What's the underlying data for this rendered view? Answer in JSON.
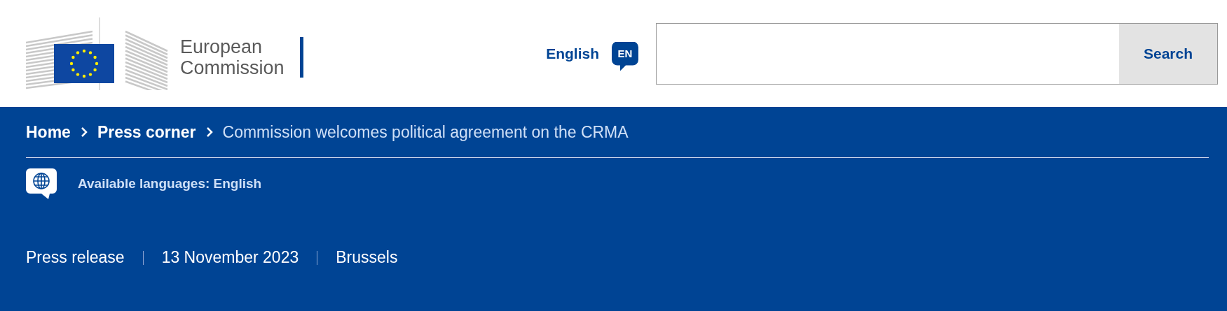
{
  "header": {
    "logo_text": [
      "European",
      "Commission"
    ],
    "language": {
      "label": "English",
      "code": "EN"
    },
    "search": {
      "button": "Search"
    }
  },
  "breadcrumb": [
    {
      "label": "Home",
      "current": false
    },
    {
      "label": "Press corner",
      "current": false
    },
    {
      "label": "Commission welcomes political agreement on the CRMA",
      "current": true
    }
  ],
  "languages": {
    "text": "Available languages: English"
  },
  "meta": [
    "Press release",
    "13 November 2023",
    "Brussels"
  ]
}
